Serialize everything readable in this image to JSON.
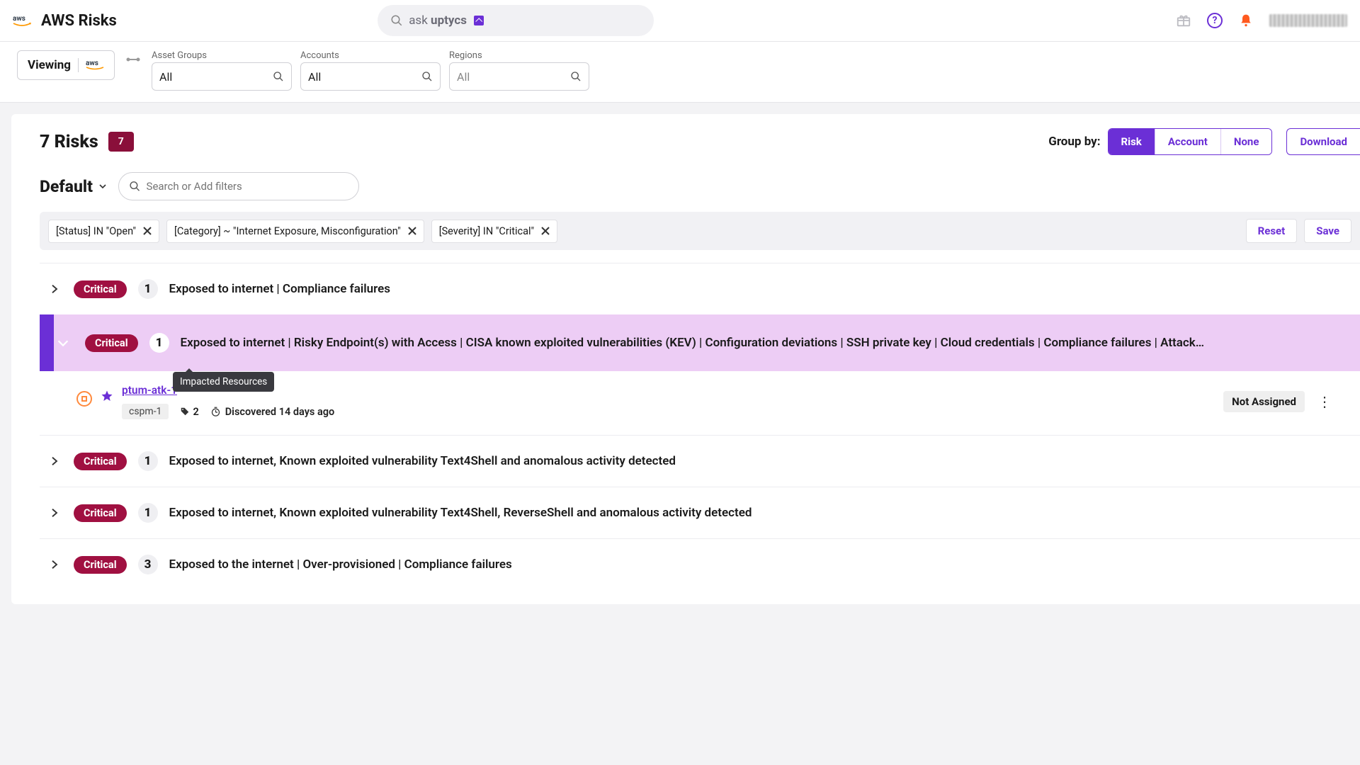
{
  "header": {
    "title": "AWS Risks",
    "search_prefix": "ask",
    "search_brand": "uptycs"
  },
  "filters": {
    "viewing_label": "Viewing",
    "asset_groups": {
      "label": "Asset Groups",
      "value": "All"
    },
    "accounts": {
      "label": "Accounts",
      "value": "All"
    },
    "regions": {
      "label": "Regions",
      "value": "All"
    }
  },
  "summary": {
    "risks_label": "7 Risks",
    "count": "7",
    "group_by_label": "Group by:",
    "group_by_options": [
      "Risk",
      "Account",
      "None"
    ],
    "download": "Download"
  },
  "subhead": {
    "default_label": "Default",
    "search_placeholder": "Search or Add filters"
  },
  "chips": {
    "items": [
      "[Status] IN \"Open\"",
      "[Category] ~ \"Internet Exposure, Misconfiguration\"",
      "[Severity] IN \"Critical\""
    ],
    "reset": "Reset",
    "save": "Save"
  },
  "tooltip": "Impacted Resources",
  "risks": [
    {
      "severity": "Critical",
      "count": "1",
      "title": "Exposed to internet | Compliance failures"
    },
    {
      "severity": "Critical",
      "count": "1",
      "title": "Exposed to internet | Risky Endpoint(s) with Access | CISA known exploited vulnerabilities (KEV) | Configuration deviations | SSH private key | Cloud credentials | Compliance failures | Attack…",
      "expanded": true
    },
    {
      "severity": "Critical",
      "count": "1",
      "title": "Exposed to internet, Known exploited vulnerability Text4Shell and anomalous activity detected"
    },
    {
      "severity": "Critical",
      "count": "1",
      "title": "Exposed to internet, Known exploited vulnerability Text4Shell, ReverseShell and anomalous activity detected"
    },
    {
      "severity": "Critical",
      "count": "3",
      "title": "Exposed to the internet | Over-provisioned | Compliance failures"
    }
  ],
  "resource": {
    "name": "ptum-atk-1",
    "account": "cspm-1",
    "tag_count": "2",
    "discovered": "Discovered 14 days ago",
    "assignment": "Not Assigned"
  }
}
